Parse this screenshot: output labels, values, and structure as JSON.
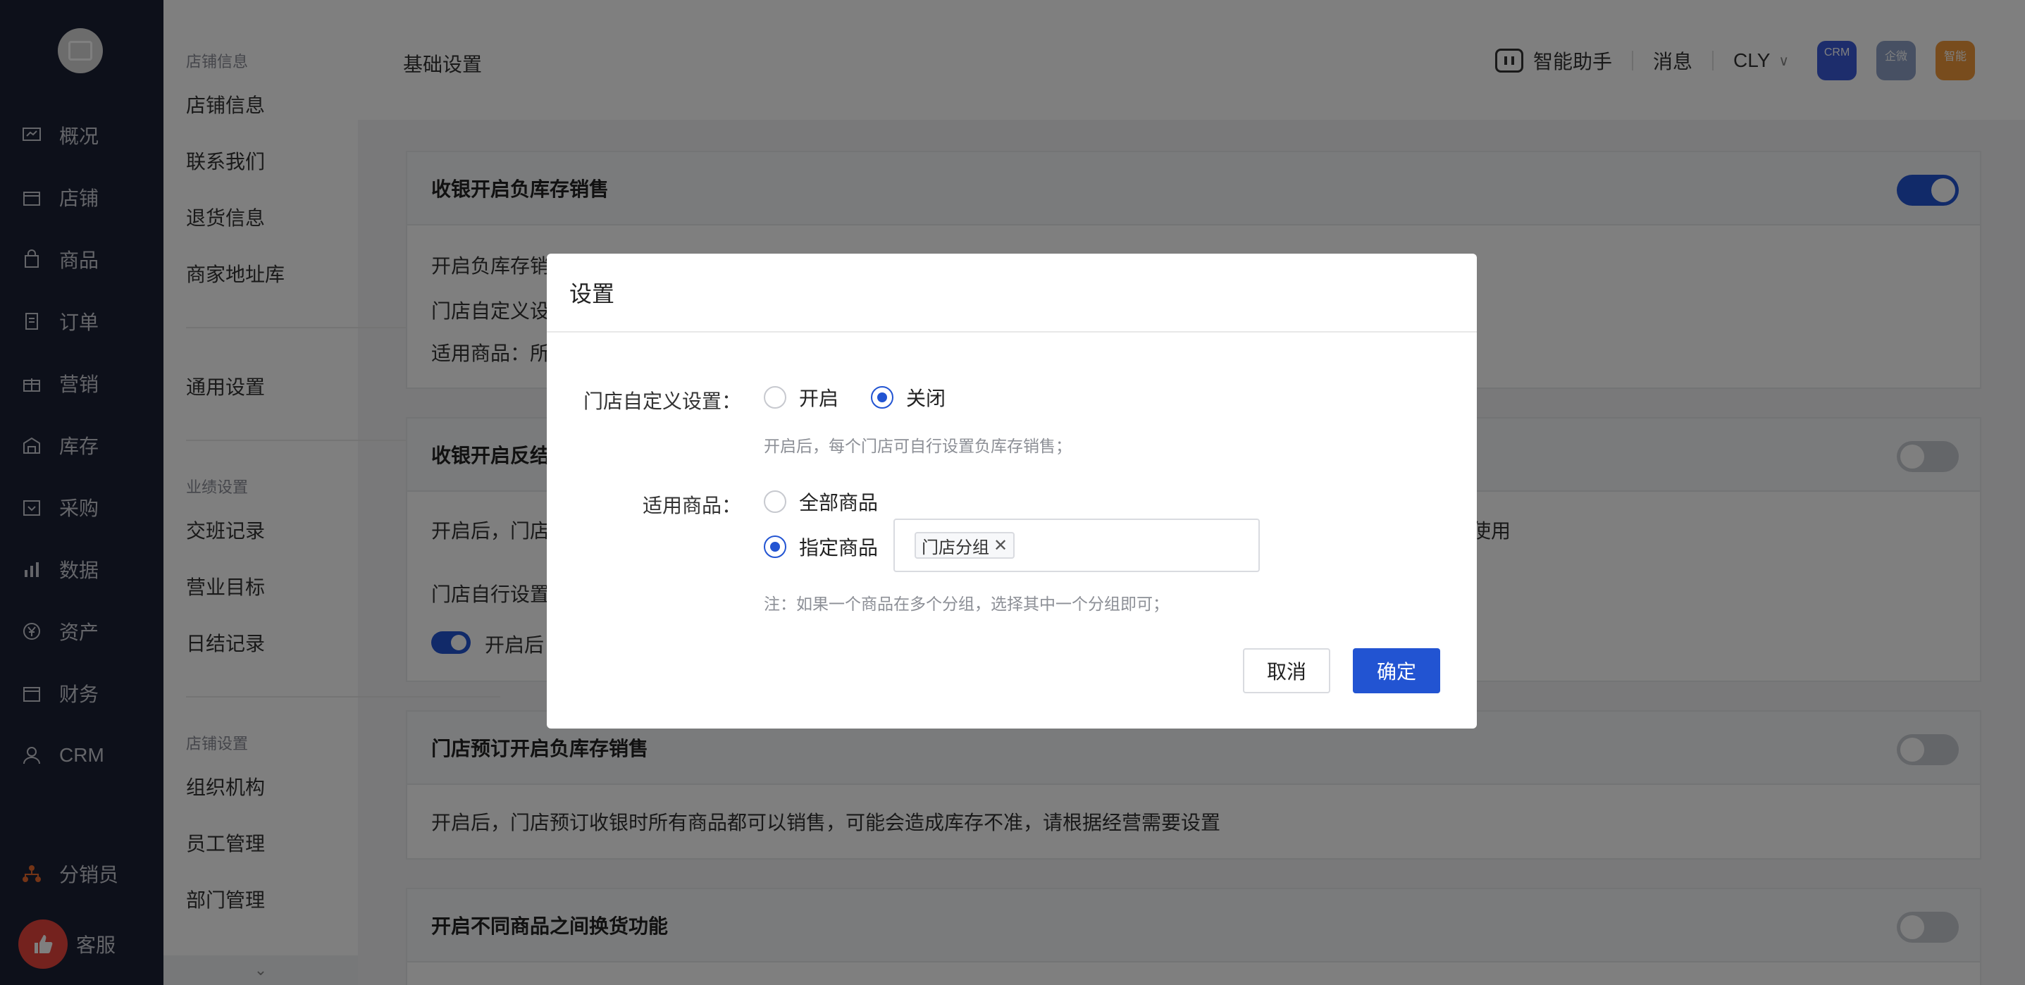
{
  "sidebar": {
    "items": [
      {
        "label": "概况",
        "icon": "dashboard-icon"
      },
      {
        "label": "店铺",
        "icon": "store-icon"
      },
      {
        "label": "商品",
        "icon": "shopping-bag-icon"
      },
      {
        "label": "订单",
        "icon": "order-icon"
      },
      {
        "label": "营销",
        "icon": "gift-icon"
      },
      {
        "label": "库存",
        "icon": "warehouse-icon"
      },
      {
        "label": "采购",
        "icon": "purchase-icon"
      },
      {
        "label": "数据",
        "icon": "bar-chart-icon"
      },
      {
        "label": "资产",
        "icon": "yen-icon"
      },
      {
        "label": "财务",
        "icon": "finance-icon"
      },
      {
        "label": "CRM",
        "icon": "user-icon"
      },
      {
        "label": "分销员",
        "icon": "org-tree-icon"
      }
    ],
    "support_label": "客服"
  },
  "subnav": {
    "group1_title": "店铺信息",
    "group1_items": [
      "店铺信息",
      "联系我们",
      "退货信息",
      "商家地址库"
    ],
    "general": "通用设置",
    "group2_title": "业绩设置",
    "group2_items": [
      "交班记录",
      "营业目标",
      "日结记录"
    ],
    "group3_title": "店铺设置",
    "group3_items": [
      "组织机构",
      "员工管理",
      "部门管理"
    ]
  },
  "header": {
    "page_title": "基础设置",
    "assistant": "智能助手",
    "messages": "消息",
    "user": "CLY",
    "apps": [
      "CRM",
      "企微",
      "智能"
    ]
  },
  "cards": {
    "c1": {
      "title": "收银开启负库存销售",
      "line1": "开启负库存销",
      "line2": "门店自定义设",
      "line3": "适用商品：所"
    },
    "c2": {
      "title": "收银开启反结",
      "line1": "开启后，门店",
      "line1_tail": "使用",
      "line2": "门店自行设置",
      "line3": "开启后"
    },
    "c3": {
      "title": "门店预订开启负库存销售",
      "line1": "开启后，门店预订收银时所有商品都可以销售，可能会造成库存不准，请根据经营需要设置"
    },
    "c4": {
      "title": "开启不同商品之间换货功能"
    }
  },
  "modal": {
    "title": "设置",
    "custom_label": "门店自定义设置：",
    "custom_on": "开启",
    "custom_off": "关闭",
    "custom_hint": "开启后，每个门店可自行设置负库存销售；",
    "goods_label": "适用商品：",
    "goods_all": "全部商品",
    "goods_specific": "指定商品",
    "tag": "门店分组",
    "note": "注：如果一个商品在多个分组，选择其中一个分组即可；",
    "cancel": "取消",
    "confirm": "确定"
  }
}
